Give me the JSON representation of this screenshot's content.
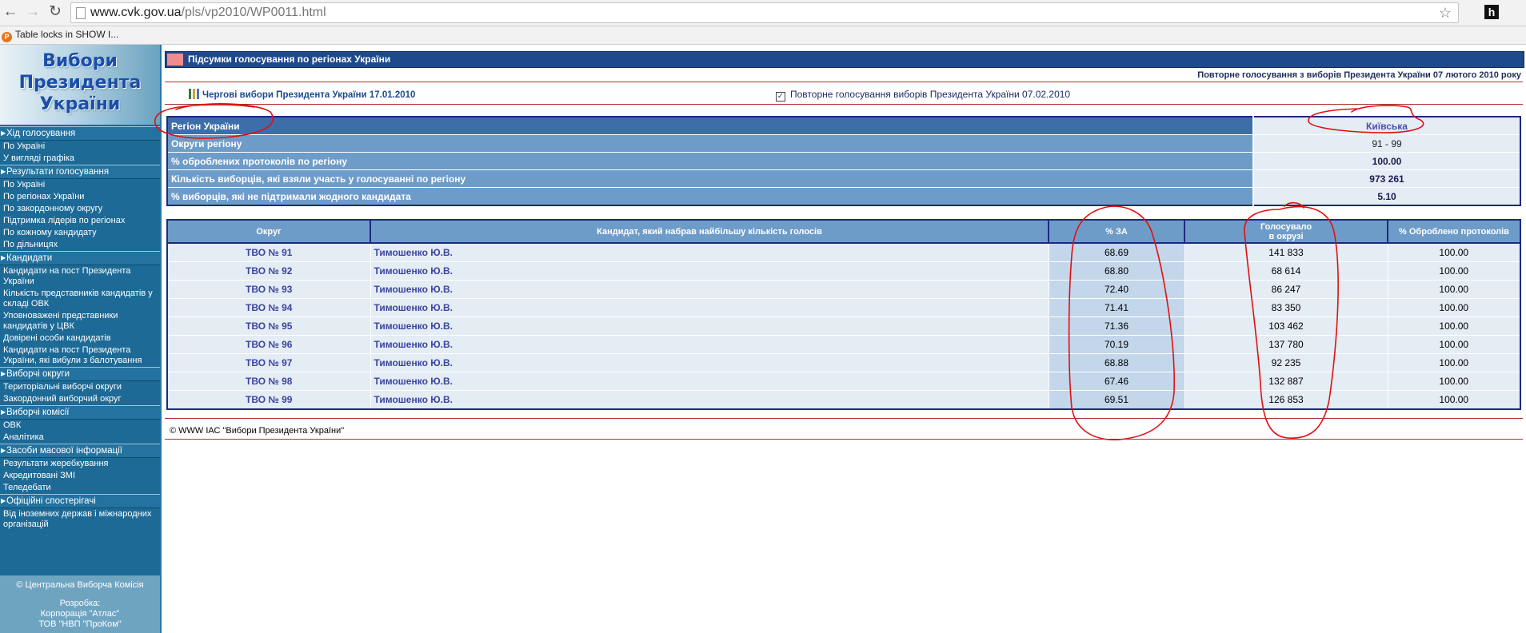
{
  "browser": {
    "url_host": "www.cvk.gov.ua",
    "url_path": "/pls/vp2010/WP0011.html",
    "bookmark_label": "Table locks in SHOW I...",
    "extension_label": "h"
  },
  "sidebar": {
    "logo_lines": [
      "Вибори",
      "Президента",
      "України"
    ],
    "menu": [
      {
        "type": "section",
        "label": "Хід голосування"
      },
      {
        "type": "item",
        "label": "По Україні"
      },
      {
        "type": "item",
        "label": "У вигляді графіка"
      },
      {
        "type": "section",
        "label": "Результати голосування"
      },
      {
        "type": "item",
        "label": "По Україні"
      },
      {
        "type": "item",
        "label": "По регіонах України"
      },
      {
        "type": "item",
        "label": "По закордонному округу"
      },
      {
        "type": "item",
        "label": "Підтримка лідерів по регіонах"
      },
      {
        "type": "item",
        "label": "По кожному кандидату"
      },
      {
        "type": "item",
        "label": "По дільницях"
      },
      {
        "type": "section",
        "label": "Кандидати"
      },
      {
        "type": "item",
        "label": "Кандидати на пост Президента України"
      },
      {
        "type": "item",
        "label": "Кількість представників кандидатів у складі ОВК"
      },
      {
        "type": "item",
        "label": "Уповноважені представники кандидатів у ЦВК"
      },
      {
        "type": "item",
        "label": "Довірені особи кандидатів"
      },
      {
        "type": "item",
        "label": "Кандидати на пост Президента України, які вибули з балотування"
      },
      {
        "type": "section",
        "label": "Виборчі округи"
      },
      {
        "type": "item",
        "label": "Територіальні виборчі округи"
      },
      {
        "type": "item",
        "label": "Закордонний виборчий округ"
      },
      {
        "type": "section",
        "label": "Виборчі комісії"
      },
      {
        "type": "item",
        "label": "ОВК"
      },
      {
        "type": "item",
        "label": "Аналітика"
      },
      {
        "type": "section",
        "label": "Засоби масової інформації"
      },
      {
        "type": "item",
        "label": "Результати жеребкування"
      },
      {
        "type": "item",
        "label": "Акредитовані ЗМІ"
      },
      {
        "type": "item",
        "label": "Теледебати"
      },
      {
        "type": "section",
        "label": "Офіційні спостерігачі"
      },
      {
        "type": "item",
        "label": "Від іноземних держав і міжнародних організацій"
      }
    ],
    "footer_copyright": "© Центральна Виборча Комісія",
    "footer_dev_title": "Розробка:",
    "footer_dev_1": "Корпорація \"Атлас\"",
    "footer_dev_2": "ТОВ \"НВП \"ПроКом\""
  },
  "main": {
    "title": "Підсумки голосування по регіонах України",
    "subtitle": "Повторне голосування з виборів Президента України 07 лютого 2010 року",
    "link_regular": "Чергові вибори Президента України 17.01.2010",
    "link_repeat": "Повторне голосування виборів Президента України 07.02.2010",
    "check_mark": "✓"
  },
  "summary": {
    "region_label": "Регіон України",
    "region_value": "Київська",
    "rows": [
      {
        "label": "Округи регіону",
        "value": "91 - 99"
      },
      {
        "label": "% оброблених протоколів по регіону",
        "value": "100.00"
      },
      {
        "label": "Кількість виборців, які взяли участь у голосуванні по регіону",
        "value": "973 261"
      },
      {
        "label": "% виборців, які не підтримали жодного кандидата",
        "value": "5.10"
      }
    ]
  },
  "results": {
    "headers": {
      "district": "Округ",
      "candidate": "Кандидат, який набрав найбільшу кількість голосів",
      "pct_for": "% ЗА",
      "voted_line1": "Голосувало",
      "voted_line2": "в окрузі",
      "processed": "% Оброблено протоколів"
    },
    "rows": [
      {
        "district": "ТВО № 91",
        "candidate": "Тимошенко Ю.В.",
        "pct": "68.69",
        "voted": "141 833",
        "processed": "100.00"
      },
      {
        "district": "ТВО № 92",
        "candidate": "Тимошенко Ю.В.",
        "pct": "68.80",
        "voted": "68 614",
        "processed": "100.00"
      },
      {
        "district": "ТВО № 93",
        "candidate": "Тимошенко Ю.В.",
        "pct": "72.40",
        "voted": "86 247",
        "processed": "100.00"
      },
      {
        "district": "ТВО № 94",
        "candidate": "Тимошенко Ю.В.",
        "pct": "71.41",
        "voted": "83 350",
        "processed": "100.00"
      },
      {
        "district": "ТВО № 95",
        "candidate": "Тимошенко Ю.В.",
        "pct": "71.36",
        "voted": "103 462",
        "processed": "100.00"
      },
      {
        "district": "ТВО № 96",
        "candidate": "Тимошенко Ю.В.",
        "pct": "70.19",
        "voted": "137 780",
        "processed": "100.00"
      },
      {
        "district": "ТВО № 97",
        "candidate": "Тимошенко Ю.В.",
        "pct": "68.88",
        "voted": "92 235",
        "processed": "100.00"
      },
      {
        "district": "ТВО № 98",
        "candidate": "Тимошенко Ю.В.",
        "pct": "67.46",
        "voted": "132 887",
        "processed": "100.00"
      },
      {
        "district": "ТВО № 99",
        "candidate": "Тимошенко Ю.В.",
        "pct": "69.51",
        "voted": "126 853",
        "processed": "100.00"
      }
    ]
  },
  "footer": {
    "text": "© WWW ІАС \"Вибори Президента України\""
  },
  "colors": {
    "annotation": "#e01010",
    "header_blue": "#1e4a8c",
    "row_blue": "#6e9cc9",
    "cell_light": "#e4ecf4"
  }
}
